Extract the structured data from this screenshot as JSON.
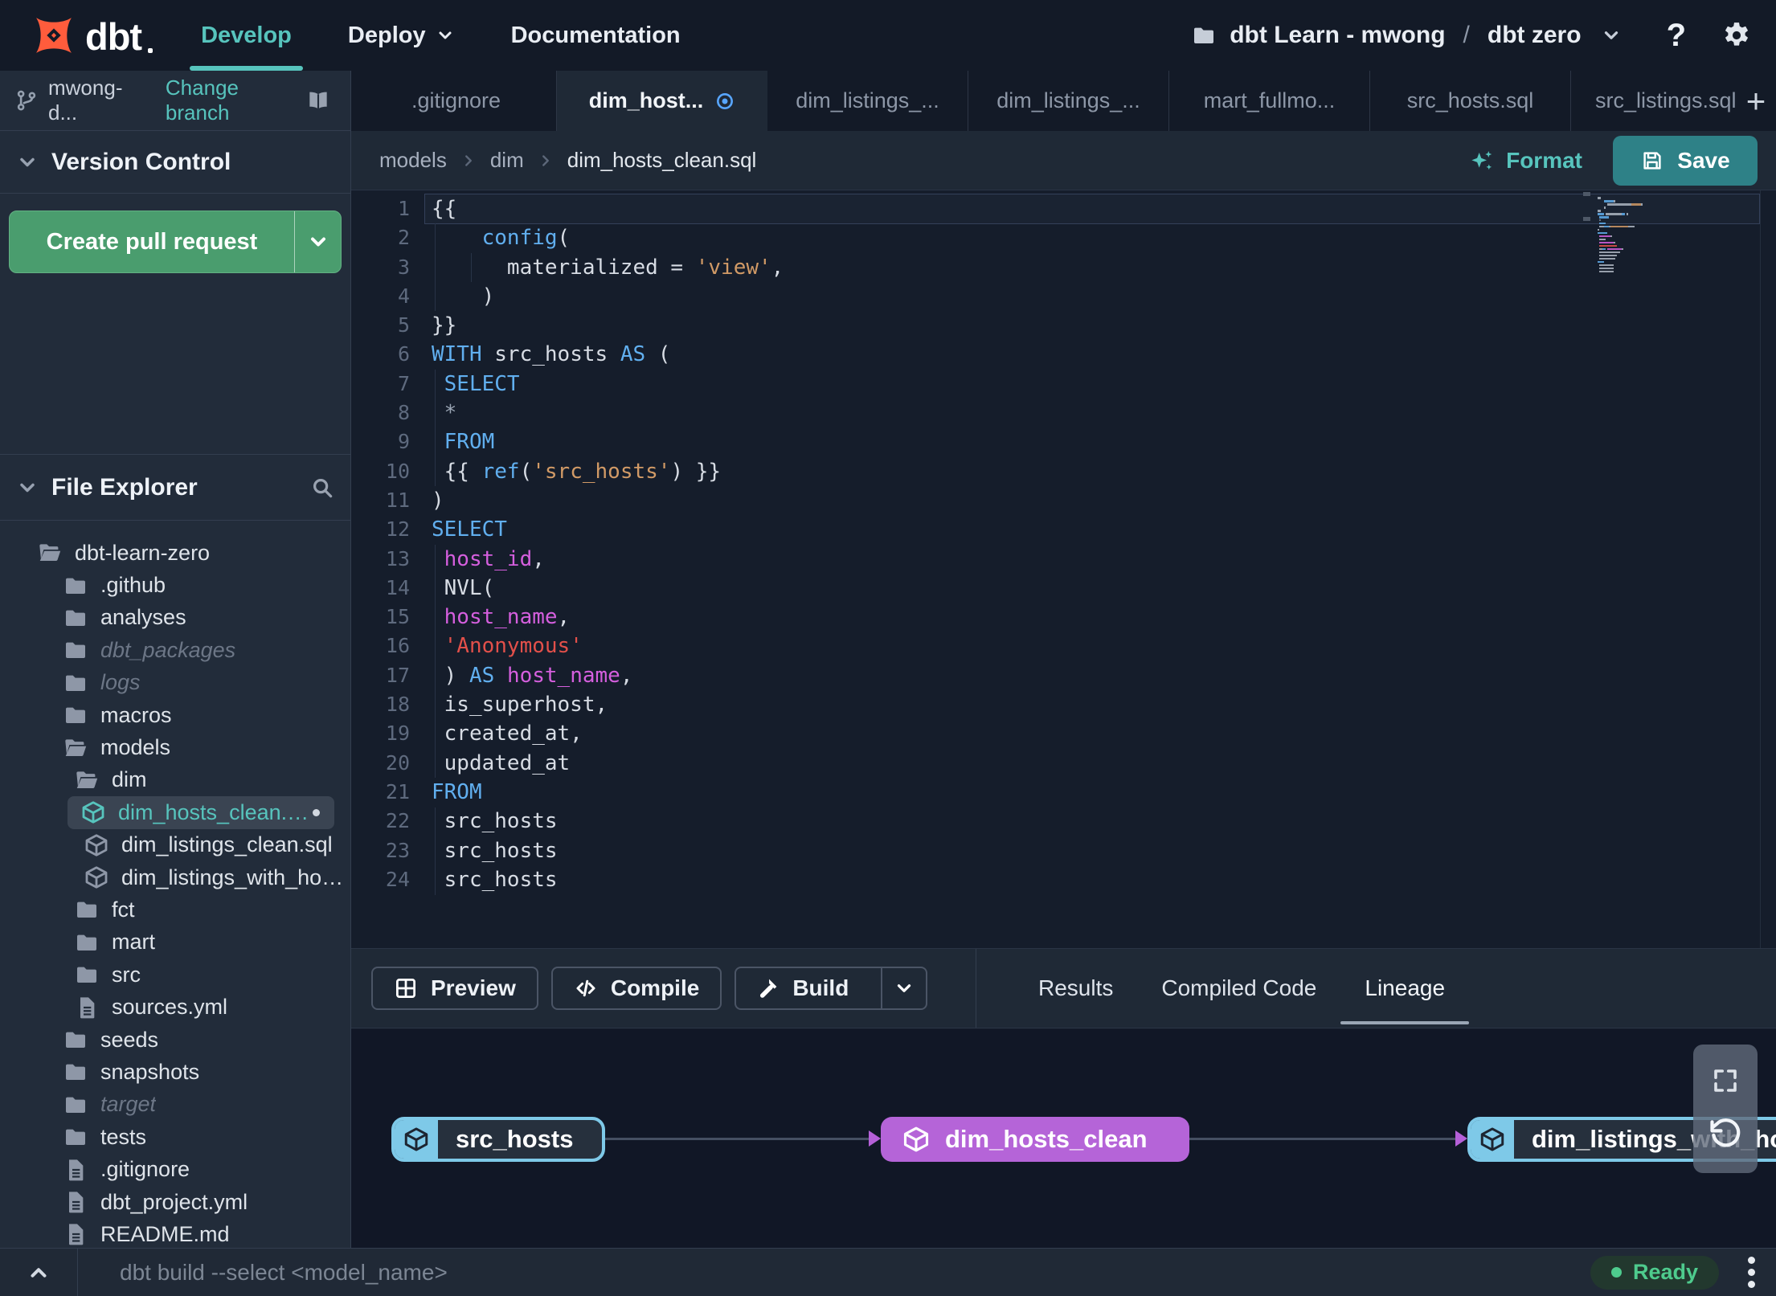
{
  "navbar": {
    "logo_text": "dbt",
    "menu": [
      {
        "label": "Develop",
        "active": true
      },
      {
        "label": "Deploy",
        "chevron": true
      },
      {
        "label": "Documentation"
      }
    ],
    "project": {
      "account": "dbt Learn - mwong",
      "separator": "/",
      "name": "dbt zero"
    },
    "help": "?"
  },
  "branch_bar": {
    "branch": "mwong-d...",
    "change": "Change branch"
  },
  "editor_tabs": {
    "items": [
      {
        "label": ".gitignore"
      },
      {
        "label": "dim_host...",
        "active": true,
        "dot": true
      },
      {
        "label": "dim_listings_..."
      },
      {
        "label": "dim_listings_..."
      },
      {
        "label": "mart_fullmo..."
      },
      {
        "label": "src_hosts.sql"
      },
      {
        "label": "src_listings.sql",
        "last": true
      }
    ],
    "add": "+"
  },
  "breadcrumb": [
    "models",
    "dim",
    "dim_hosts_clean.sql"
  ],
  "actions": {
    "format": "Format",
    "save": "Save"
  },
  "version_control": {
    "title": "Version Control",
    "button": "Create pull request"
  },
  "file_explorer": {
    "title": "File Explorer",
    "tree": [
      {
        "name": "dbt-learn-zero",
        "icon": "folder-open",
        "level": 0
      },
      {
        "name": ".github",
        "icon": "folder",
        "level": 1
      },
      {
        "name": "analyses",
        "icon": "folder",
        "level": 1
      },
      {
        "name": "dbt_packages",
        "icon": "folder",
        "level": 1,
        "muted": true
      },
      {
        "name": "logs",
        "icon": "folder",
        "level": 1,
        "muted": true
      },
      {
        "name": "macros",
        "icon": "folder",
        "level": 1
      },
      {
        "name": "models",
        "icon": "folder-open",
        "level": 1
      },
      {
        "name": "dim",
        "icon": "folder-open",
        "level": 2
      },
      {
        "name": "dim_hosts_clean.sql",
        "icon": "model",
        "level": 3,
        "selected": true,
        "dot": true
      },
      {
        "name": "dim_listings_clean.sql",
        "icon": "model",
        "level": 3
      },
      {
        "name": "dim_listings_with_hosts...",
        "icon": "model",
        "level": 3
      },
      {
        "name": "fct",
        "icon": "folder",
        "level": 2
      },
      {
        "name": "mart",
        "icon": "folder",
        "level": 2
      },
      {
        "name": "src",
        "icon": "folder",
        "level": 2
      },
      {
        "name": "sources.yml",
        "icon": "file",
        "level": 2
      },
      {
        "name": "seeds",
        "icon": "folder",
        "level": 1
      },
      {
        "name": "snapshots",
        "icon": "folder",
        "level": 1
      },
      {
        "name": "target",
        "icon": "folder",
        "level": 1,
        "muted": true
      },
      {
        "name": "tests",
        "icon": "folder",
        "level": 1
      },
      {
        "name": ".gitignore",
        "icon": "file",
        "level": 1
      },
      {
        "name": "dbt_project.yml",
        "icon": "file",
        "level": 1
      },
      {
        "name": "README.md",
        "icon": "file",
        "level": 1
      }
    ]
  },
  "editor": {
    "lines": [
      {
        "n": 1,
        "tokens": [
          [
            "p",
            "{{"
          ]
        ],
        "current": true
      },
      {
        "n": 2,
        "tokens": [
          [
            "p",
            "    "
          ],
          [
            "k",
            "config"
          ],
          [
            "p",
            "("
          ]
        ]
      },
      {
        "n": 3,
        "tokens": [
          [
            "p",
            "      materialized = "
          ],
          [
            "s",
            "'view'"
          ],
          [
            "p",
            ","
          ]
        ]
      },
      {
        "n": 4,
        "tokens": [
          [
            "p",
            "    )"
          ]
        ]
      },
      {
        "n": 5,
        "tokens": [
          [
            "p",
            "}}"
          ]
        ]
      },
      {
        "n": 6,
        "tokens": [
          [
            "k",
            "WITH"
          ],
          [
            "p",
            " src_hosts "
          ],
          [
            "k",
            "AS"
          ],
          [
            "p",
            " ("
          ]
        ]
      },
      {
        "n": 7,
        "tokens": [
          [
            "p",
            " "
          ],
          [
            "k",
            "SELECT"
          ]
        ]
      },
      {
        "n": 8,
        "tokens": [
          [
            "p",
            " "
          ],
          [
            "d",
            "*"
          ]
        ]
      },
      {
        "n": 9,
        "tokens": [
          [
            "p",
            " "
          ],
          [
            "k",
            "FROM"
          ]
        ]
      },
      {
        "n": 10,
        "tokens": [
          [
            "p",
            " {{ "
          ],
          [
            "k",
            "ref"
          ],
          [
            "p",
            "("
          ],
          [
            "s",
            "'src_hosts'"
          ],
          [
            "p",
            ") }}"
          ]
        ]
      },
      {
        "n": 11,
        "tokens": [
          [
            "p",
            ")"
          ]
        ]
      },
      {
        "n": 12,
        "tokens": [
          [
            "k",
            "SELECT"
          ]
        ]
      },
      {
        "n": 13,
        "tokens": [
          [
            "p",
            " "
          ],
          [
            "i",
            "host_id"
          ],
          [
            "p",
            ","
          ]
        ]
      },
      {
        "n": 14,
        "tokens": [
          [
            "p",
            " NVL("
          ]
        ]
      },
      {
        "n": 15,
        "tokens": [
          [
            "p",
            " "
          ],
          [
            "i",
            "host_name"
          ],
          [
            "p",
            ","
          ]
        ]
      },
      {
        "n": 16,
        "tokens": [
          [
            "p",
            " "
          ],
          [
            "r",
            "'Anonymous'"
          ]
        ]
      },
      {
        "n": 17,
        "tokens": [
          [
            "p",
            " ) "
          ],
          [
            "k",
            "AS"
          ],
          [
            "p",
            " "
          ],
          [
            "i",
            "host_name"
          ],
          [
            "p",
            ","
          ]
        ]
      },
      {
        "n": 18,
        "tokens": [
          [
            "p",
            " is_superhost,"
          ]
        ]
      },
      {
        "n": 19,
        "tokens": [
          [
            "p",
            " created_at,"
          ]
        ]
      },
      {
        "n": 20,
        "tokens": [
          [
            "p",
            " updated_at"
          ]
        ]
      },
      {
        "n": 21,
        "tokens": [
          [
            "k",
            "FROM"
          ]
        ]
      },
      {
        "n": 22,
        "tokens": [
          [
            "p",
            " src_hosts"
          ]
        ]
      },
      {
        "n": 23,
        "tokens": [
          [
            "p",
            " src_hosts"
          ]
        ]
      },
      {
        "n": 24,
        "tokens": [
          [
            "p",
            " src_hosts"
          ]
        ]
      }
    ]
  },
  "bottom_panel": {
    "buttons": [
      {
        "label": "Preview",
        "icon": "grid"
      },
      {
        "label": "Compile",
        "icon": "code"
      },
      {
        "label": "Build",
        "icon": "hammer",
        "split": true
      }
    ],
    "tabs": [
      {
        "label": "Results"
      },
      {
        "label": "Compiled Code"
      },
      {
        "label": "Lineage",
        "active": true
      }
    ]
  },
  "lineage": {
    "nodes": [
      {
        "label": "src_hosts",
        "kind": "source"
      },
      {
        "label": "dim_hosts_clean",
        "kind": "model"
      },
      {
        "label": "dim_listings_with_hosts",
        "kind": "source"
      }
    ]
  },
  "status_bar": {
    "command": "dbt build --select <model_name>",
    "status": "Ready"
  },
  "colors": {
    "accent_teal": "#57c4bd",
    "save_teal": "#2e8187",
    "pr_green": "#4a9d6e",
    "node_blue": "#7ec9e8",
    "node_purple": "#b564d8",
    "ready_green": "#4ecb8d",
    "tab_dot_blue": "#58a6ff",
    "logo_orange": "#ff5c3c",
    "code_keyword": "#61afef",
    "code_string": "#d19a66",
    "code_string_red": "#e3504a",
    "code_identifier": "#d55fde"
  }
}
